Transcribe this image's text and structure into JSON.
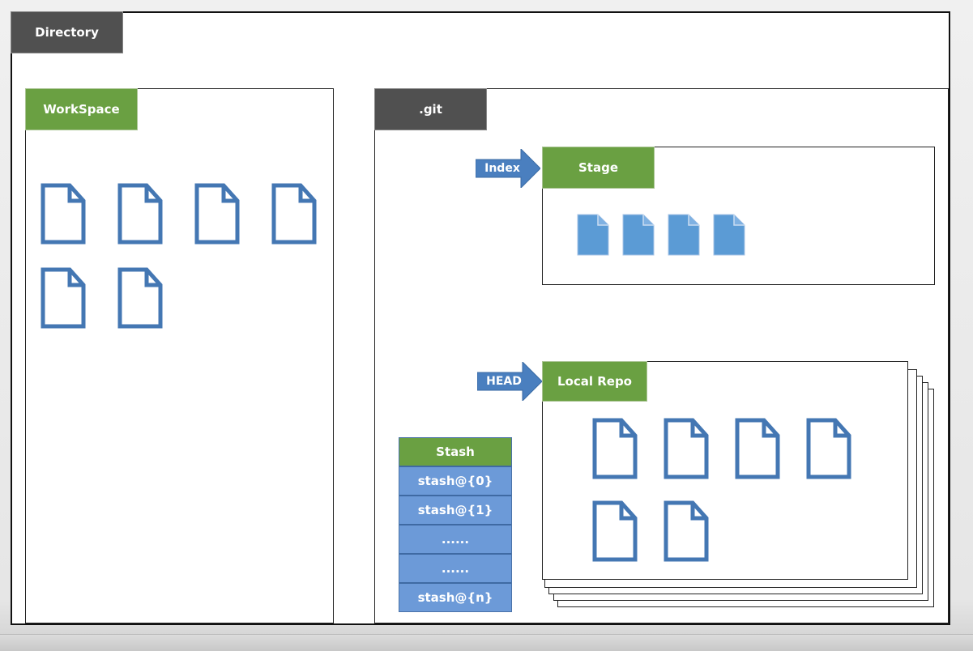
{
  "directory": {
    "label": "Directory"
  },
  "workspace": {
    "label": "WorkSpace",
    "file_count": 6,
    "file_icon": "file-outline-icon"
  },
  "git": {
    "label": ".git",
    "stage": {
      "label": "Stage",
      "pointer_label": "Index",
      "file_count": 4,
      "file_icon": "file-filled-icon"
    },
    "local_repo": {
      "label": "Local Repo",
      "pointer_label": "HEAD",
      "file_count": 6,
      "file_icon": "file-outline-icon"
    },
    "stash": {
      "label": "Stash",
      "entries": [
        "stash@{0}",
        "stash@{1}",
        "......",
        "......",
        "stash@{n}"
      ]
    }
  },
  "colors": {
    "dark_tag": "#505050",
    "green_tag": "#6aa042",
    "file_blue": "#4477b3",
    "file_fill": "#5b9bd5",
    "stash_blue": "#6c9ad8",
    "arrow_blue": "#4a7fbf"
  }
}
